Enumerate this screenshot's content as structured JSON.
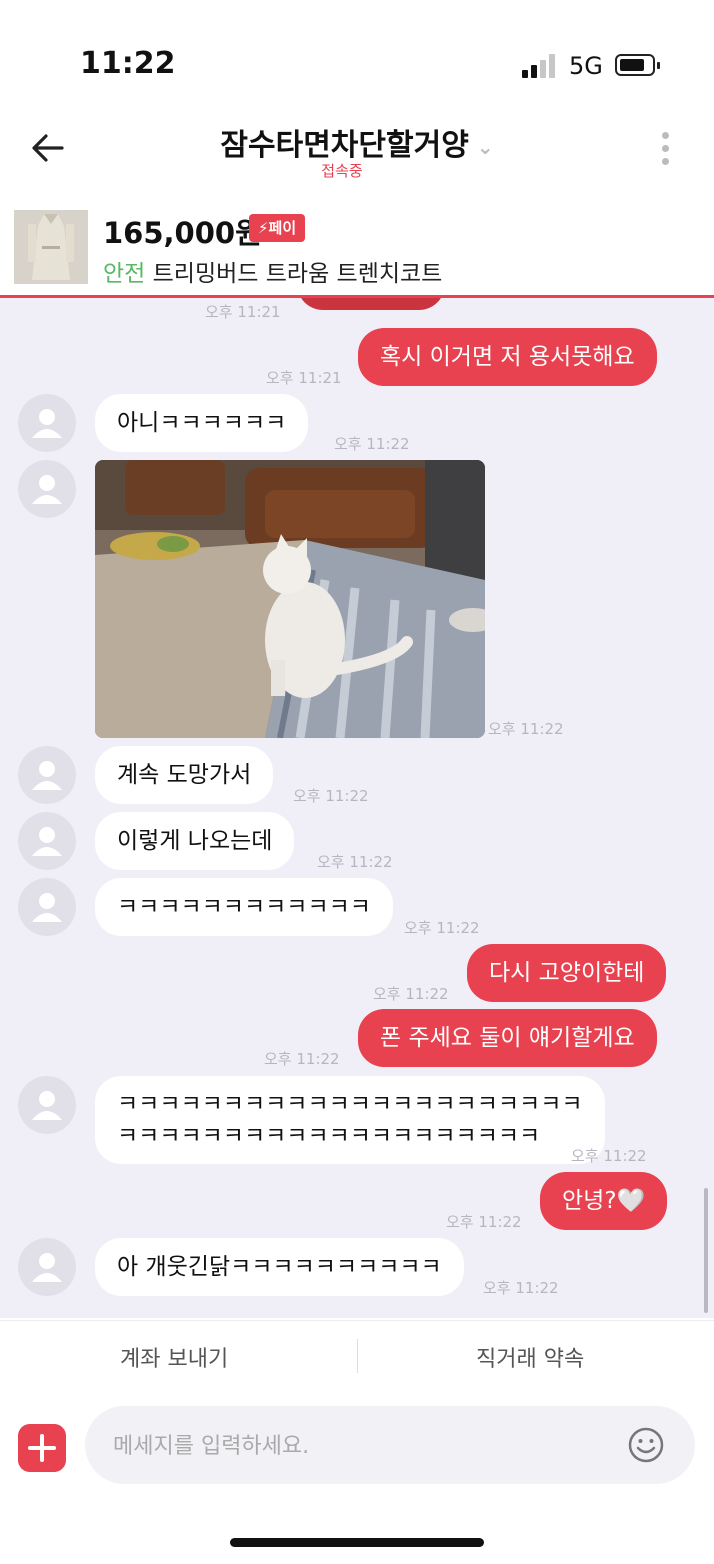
{
  "status_bar": {
    "time": "11:22",
    "network": "5G"
  },
  "header": {
    "title": "잠수타면차단할거양",
    "subtitle": "접속중"
  },
  "product": {
    "price": "165,000원",
    "pay_badge": "⚡페이",
    "safe_label": "안전",
    "name": "트리밍버드 트라움 트렌치코트"
  },
  "messages": {
    "m0": {
      "time": "오후 11:21"
    },
    "m1": {
      "text": "혹시 이거면 저 용서못해요",
      "time": "오후 11:21"
    },
    "m2": {
      "text": "아니ㅋㅋㅋㅋㅋㅋ",
      "time": "오후 11:22"
    },
    "m3": {
      "time": "오후 11:22"
    },
    "m4": {
      "text": "계속 도망가서",
      "time": "오후 11:22"
    },
    "m5": {
      "text": "이렇게 나오는데",
      "time": "오후 11:22"
    },
    "m6": {
      "text": "ㅋㅋㅋㅋㅋㅋㅋㅋㅋㅋㅋㅋ",
      "time": "오후 11:22"
    },
    "m7": {
      "text": "다시 고양이한테",
      "time": "오후 11:22"
    },
    "m8": {
      "text": "폰 주세요 둘이 얘기할게요",
      "time": "오후 11:22"
    },
    "m9": {
      "text": "ㅋㅋㅋㅋㅋㅋㅋㅋㅋㅋㅋㅋㅋㅋㅋㅋㅋㅋㅋㅋㅋㅋ\nㅋㅋㅋㅋㅋㅋㅋㅋㅋㅋㅋㅋㅋㅋㅋㅋㅋㅋㅋㅋ",
      "time": "오후 11:22"
    },
    "m10": {
      "text": "안녕?🤍",
      "time": "오후 11:22"
    },
    "m11": {
      "text": "아 개웃긴닭ㅋㅋㅋㅋㅋㅋㅋㅋㅋㅋ",
      "time": "오후 11:22"
    }
  },
  "actions": {
    "send_money": "계좌 보내기",
    "direct_deal": "직거래 약속"
  },
  "input": {
    "placeholder": "메세지를 입력하세요."
  },
  "colors": {
    "accent": "#e8414f",
    "chat_bg": "#f0eff7",
    "safe_green": "#58b864"
  },
  "icons": [
    "back-arrow-icon",
    "chevron-down-icon",
    "more-vertical-icon",
    "plus-icon",
    "smiley-icon",
    "avatar-icon"
  ]
}
